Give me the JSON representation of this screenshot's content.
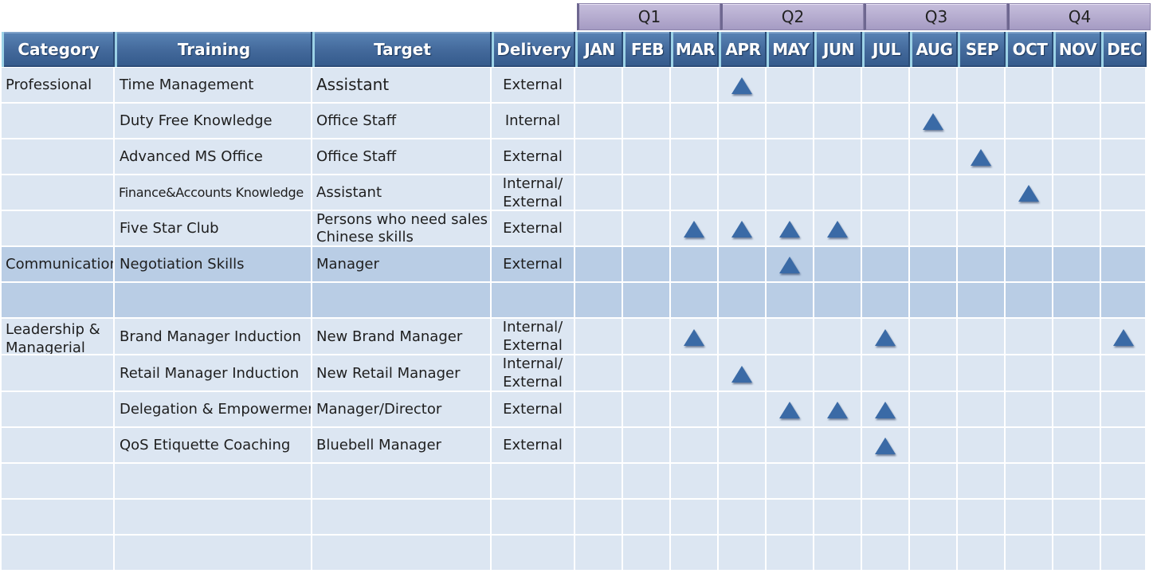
{
  "quarters": [
    "Q1",
    "Q2",
    "Q3",
    "Q4"
  ],
  "headers": {
    "category": "Category",
    "training": "Training",
    "target": "Target",
    "delivery": "Delivery",
    "months": [
      "JAN",
      "FEB",
      "MAR",
      "APR",
      "MAY",
      "JUN",
      "JUL",
      "AUG",
      "SEP",
      "OCT",
      "NOV",
      "DEC"
    ]
  },
  "rows": [
    {
      "category": "Professional",
      "training": "Time Management",
      "target": "Assistant",
      "delivery": "External",
      "scheduled": [
        "APR"
      ]
    },
    {
      "category": "",
      "training": "Duty Free Knowledge",
      "target": "Office Staff",
      "delivery": "Internal",
      "scheduled": [
        "AUG"
      ]
    },
    {
      "category": "",
      "training": "Advanced MS Office",
      "target": "Office Staff",
      "delivery": "External",
      "scheduled": [
        "SEP"
      ]
    },
    {
      "category": "",
      "training": "Finance&Accounts Knowledge",
      "target": "Assistant",
      "delivery": "Internal/ External",
      "scheduled": [
        "OCT"
      ]
    },
    {
      "category": "",
      "training": "Five Star Club",
      "target": "Persons who need sales Chinese skills",
      "delivery": "External",
      "scheduled": [
        "MAR",
        "APR",
        "MAY",
        "JUN"
      ]
    },
    {
      "category": "Communication",
      "training": "Negotiation Skills",
      "target": "Manager",
      "delivery": "External",
      "scheduled": [
        "MAY"
      ]
    },
    {
      "category": "",
      "training": "",
      "target": "",
      "delivery": "",
      "scheduled": []
    },
    {
      "category": "Leadership & Managerial",
      "training": "Brand Manager Induction",
      "target": "New Brand Manager",
      "delivery": "Internal/ External",
      "scheduled": [
        "MAR",
        "JUL",
        "DEC"
      ]
    },
    {
      "category": "",
      "training": "Retail Manager Induction",
      "target": "New Retail Manager",
      "delivery": "Internal/ External",
      "scheduled": [
        "APR"
      ]
    },
    {
      "category": "",
      "training": "Delegation & Empowerment",
      "target": "Manager/Director",
      "delivery": "External",
      "scheduled": [
        "MAY",
        "JUN",
        "JUL"
      ]
    },
    {
      "category": "",
      "training": "QoS Etiquette Coaching",
      "target": "Bluebell Manager",
      "delivery": "External",
      "scheduled": [
        "JUL"
      ]
    },
    {
      "category": "",
      "training": "",
      "target": "",
      "delivery": "",
      "scheduled": []
    },
    {
      "category": "",
      "training": "",
      "target": "",
      "delivery": "",
      "scheduled": []
    },
    {
      "category": "",
      "training": "",
      "target": "",
      "delivery": "",
      "scheduled": []
    }
  ],
  "colors": {
    "header_blue": "#42689a",
    "quarter_purple": "#b3aacd",
    "row_light": "#dce6f2",
    "row_dark": "#b9cde5",
    "marker_blue": "#3a6aa6"
  },
  "marker_icon": "triangle-up-icon"
}
